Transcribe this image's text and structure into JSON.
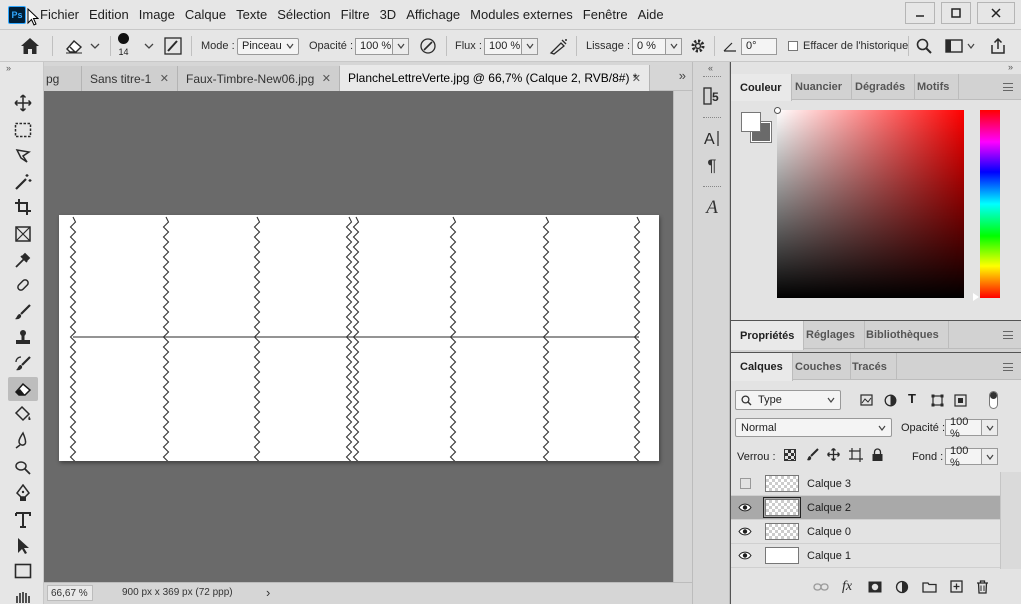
{
  "app": {
    "logo": "Ps",
    "menu": [
      "Fichier",
      "Edition",
      "Image",
      "Calque",
      "Texte",
      "Sélection",
      "Filtre",
      "3D",
      "Affichage",
      "Modules externes",
      "Fenêtre",
      "Aide"
    ]
  },
  "options": {
    "brush_size": "14",
    "mode_label": "Mode :",
    "mode_value": "Pinceau",
    "opacity_label": "Opacité :",
    "opacity_value": "100 %",
    "flow_label": "Flux :",
    "flow_value": "100 %",
    "smoothing_label": "Lissage :",
    "smoothing_value": "0 %",
    "angle_value": "0°",
    "erase_history_label": "Effacer de l'historique"
  },
  "tabs": [
    {
      "label": "pg"
    },
    {
      "label": "Sans titre-1"
    },
    {
      "label": "Faux-Timbre-New06.jpg"
    },
    {
      "label": "PlancheLettreVerte.jpg @ 66,7% (Calque 2, RVB/8#) *"
    }
  ],
  "status": {
    "zoom": "66,67 %",
    "doc_info": "900 px x 369 px (72 ppp)"
  },
  "panels": {
    "color_tabs": [
      "Couleur",
      "Nuancier",
      "Dégradés",
      "Motifs"
    ],
    "properties_tabs": [
      "Propriétés",
      "Réglages",
      "Bibliothèques"
    ],
    "layers_tabs": [
      "Calques",
      "Couches",
      "Tracés"
    ],
    "filter_kind": "Type",
    "blend_mode": "Normal",
    "opacity_label": "Opacité :",
    "opacity_value": "100 %",
    "lock_label": "Verrou :",
    "fill_label": "Fond :",
    "fill_value": "100 %"
  },
  "layers": [
    {
      "name": "Calque 3",
      "visible": false,
      "selected": false,
      "transparent": true
    },
    {
      "name": "Calque 2",
      "visible": true,
      "selected": true,
      "transparent": true
    },
    {
      "name": "Calque 0",
      "visible": true,
      "selected": false,
      "transparent": true
    },
    {
      "name": "Calque 1",
      "visible": true,
      "selected": false,
      "transparent": false
    }
  ],
  "colors": {
    "foreground": "#ffffff",
    "background": "#6a6a6a",
    "picker_hue": "#ff0000"
  }
}
